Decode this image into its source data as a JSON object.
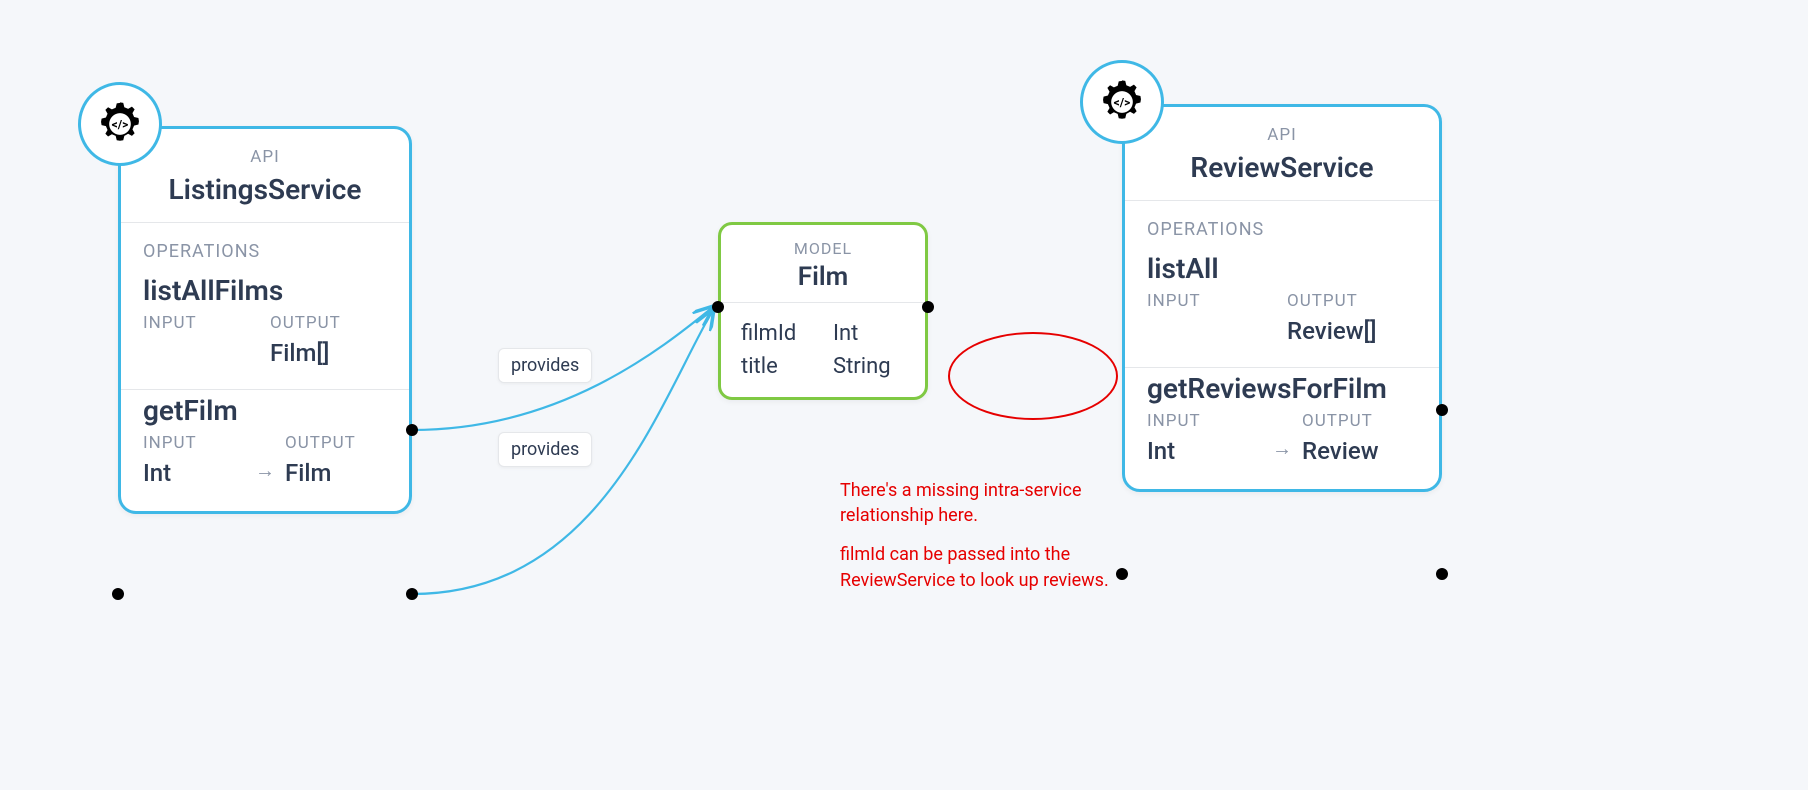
{
  "listings": {
    "kind_label": "API",
    "title": "ListingsService",
    "ops_label": "OPERATIONS",
    "ops": [
      {
        "name": "listAllFilms",
        "input_label": "INPUT",
        "output_label": "OUTPUT",
        "input": "",
        "output": "Film[]"
      },
      {
        "name": "getFilm",
        "input_label": "INPUT",
        "output_label": "OUTPUT",
        "input": "Int",
        "arrow": "→",
        "output": "Film"
      }
    ]
  },
  "review": {
    "kind_label": "API",
    "title": "ReviewService",
    "ops_label": "OPERATIONS",
    "ops": [
      {
        "name": "listAll",
        "input_label": "INPUT",
        "output_label": "OUTPUT",
        "input": "",
        "output": "Review[]"
      },
      {
        "name": "getReviewsForFilm",
        "input_label": "INPUT",
        "output_label": "OUTPUT",
        "input": "Int",
        "arrow": "→",
        "output": "Review"
      }
    ]
  },
  "model": {
    "kind_label": "MODEL",
    "title": "Film",
    "fields": [
      {
        "name": "filmId",
        "type": "Int"
      },
      {
        "name": "title",
        "type": "String"
      }
    ]
  },
  "edges": {
    "provides1": "provides",
    "provides2": "provides"
  },
  "annotation": {
    "line1": "There's a missing intra-service relationship here.",
    "line2": "filmId can be passed into the ReviewService to look up reviews."
  }
}
